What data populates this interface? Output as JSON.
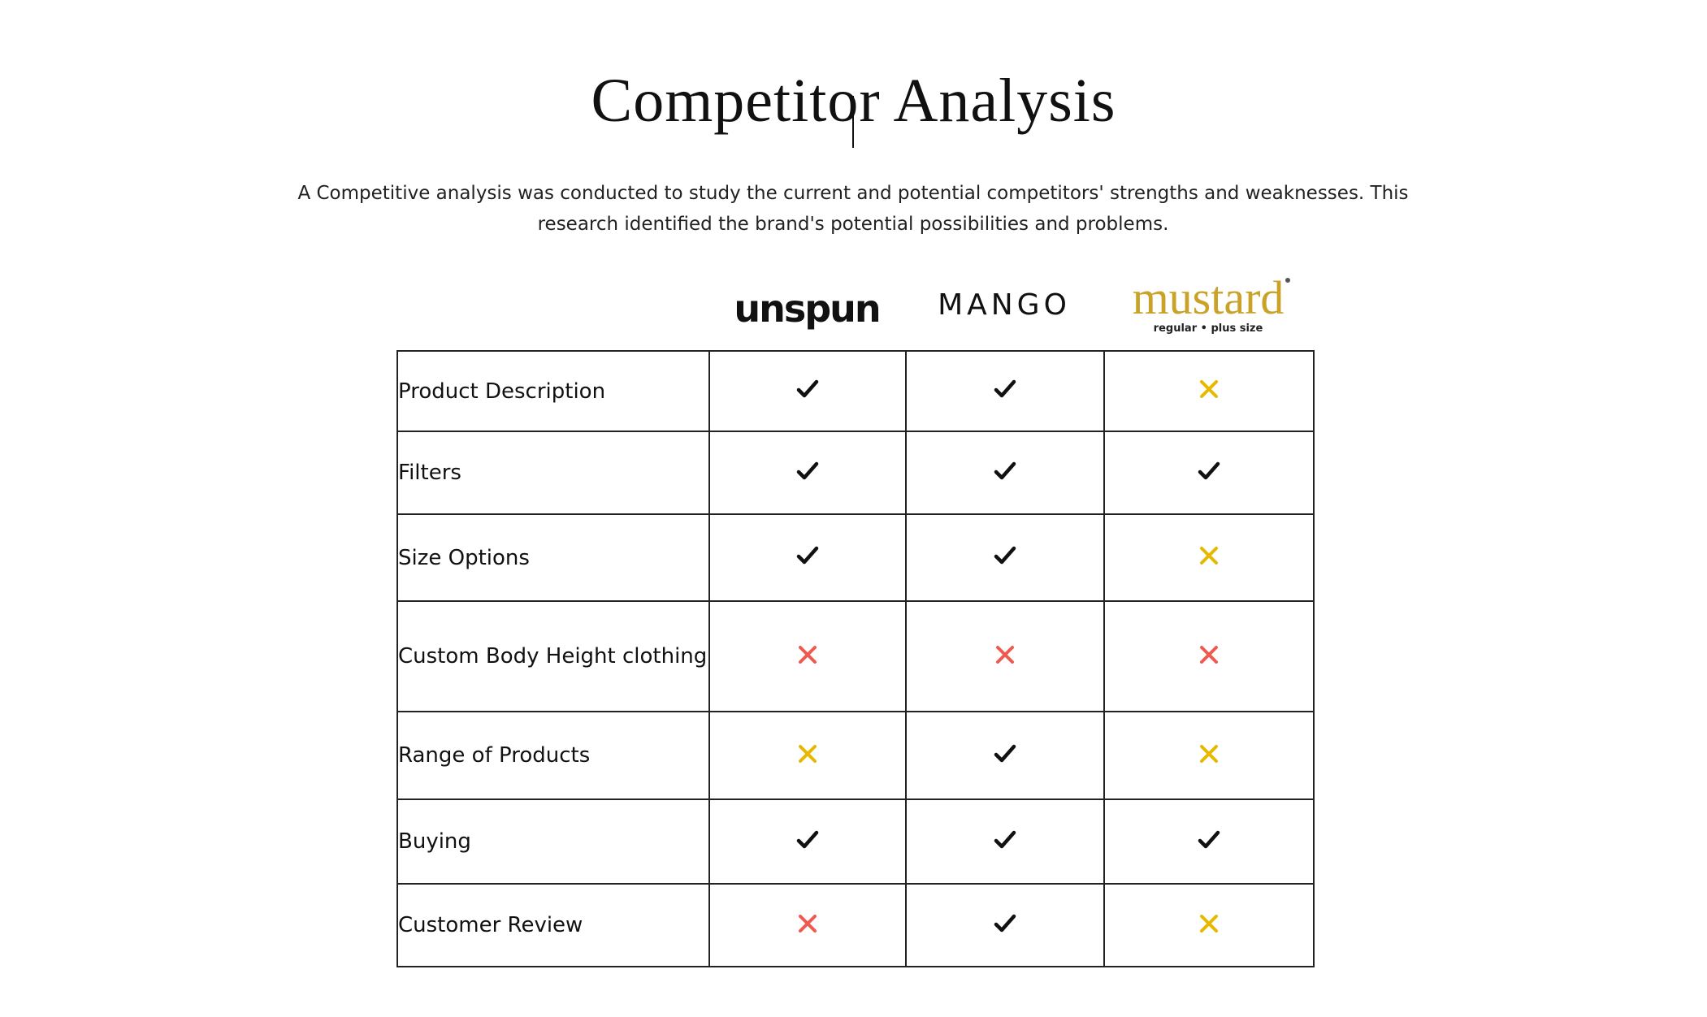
{
  "page": {
    "title": "Competitor Analysis",
    "intro": "A Competitive analysis was conducted to study the current and potential competitors' strengths and weaknesses. This research identified the brand's potential possibilities and problems."
  },
  "brands": [
    {
      "name": "unspun"
    },
    {
      "name": "MANGO"
    },
    {
      "name": "mustard",
      "tagline": "regular • plus size"
    }
  ],
  "colors": {
    "check": "#111111",
    "cross_partial": "#e6b800",
    "cross_no": "#ef5a50",
    "mustard_brand": "#c9a227"
  },
  "legend_icons": {
    "yes": "check-icon",
    "partial": "yellow-cross-icon",
    "no": "red-cross-icon"
  },
  "table": {
    "rows": [
      {
        "feature": "Product Description",
        "marks": [
          "yes",
          "yes",
          "partial"
        ]
      },
      {
        "feature": "Filters",
        "marks": [
          "yes",
          "yes",
          "yes"
        ]
      },
      {
        "feature": "Size Options",
        "marks": [
          "yes",
          "yes",
          "partial"
        ]
      },
      {
        "feature": "Custom Body Height clothing",
        "marks": [
          "no",
          "no",
          "no"
        ]
      },
      {
        "feature": "Range of Products",
        "marks": [
          "partial",
          "yes",
          "partial"
        ]
      },
      {
        "feature": "Buying",
        "marks": [
          "yes",
          "yes",
          "yes"
        ]
      },
      {
        "feature": "Customer Review",
        "marks": [
          "no",
          "yes",
          "partial"
        ]
      }
    ]
  }
}
